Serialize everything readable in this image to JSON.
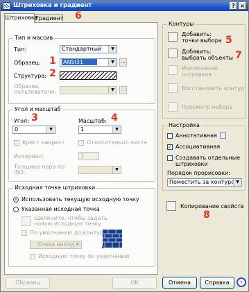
{
  "window": {
    "title": "Штриховка и градиент",
    "help": "?",
    "close": "×"
  },
  "tabs": [
    {
      "label": "Штриховка"
    },
    {
      "label": "Градиент"
    }
  ],
  "markers": [
    "1",
    "2",
    "3",
    "4",
    "5",
    "6",
    "7",
    "8"
  ],
  "type_group": {
    "title": "Тип и массив",
    "type_label": "Тип:",
    "type_value": "Стандартный",
    "pattern_label": "Образец:",
    "pattern_value": "ANSI31",
    "pattern_more": "...",
    "structure_label": "Структура:",
    "custom_label": "Образец пользователя:",
    "custom_more": "..."
  },
  "angle_group": {
    "title": "Угол и масштаб",
    "angle_label": "Угол:",
    "angle_value": "0",
    "scale_label": "Масштаб:",
    "scale_value": "1",
    "double_label": "Крест накрест",
    "relative_label": "Относительно листа",
    "interval_label": "Интервал:",
    "interval_value": "1",
    "pen_label": "Толщина пера по ISO:"
  },
  "origin_group": {
    "title": "Исходная точка штриховки",
    "use_current": "Использовать текущую исходную точку",
    "specified": "Указанная исходная точка",
    "click_to_set": "Щелкните, чтобы задать новую исходную точку",
    "default_boundary": "По умолчанию до контура",
    "position_value": "Слева внизу",
    "store_default": "Исходную точку по умолчанию"
  },
  "boundaries": {
    "title": "Контуры",
    "add_points": "Добавить: точки выбора",
    "add_objects": "Добавить: выбрать объекты",
    "remove_islands": "Исключение островков",
    "recreate": "Восстановить контур",
    "view_selection": "Просмотр набора"
  },
  "options": {
    "title": "Настройка",
    "annotative": "Аннотативная",
    "associative": "Ассоциативная",
    "create_separate": "Создавать отдельные штриховки",
    "draw_order_label": "Порядок прорисовки:",
    "draw_order_value": "Поместить за контуром"
  },
  "inherit": "Копирование свойств",
  "footer": {
    "preview": "Образец",
    "ok": "OK",
    "cancel": "Отмена",
    "help": "Справка",
    "more": "›"
  }
}
